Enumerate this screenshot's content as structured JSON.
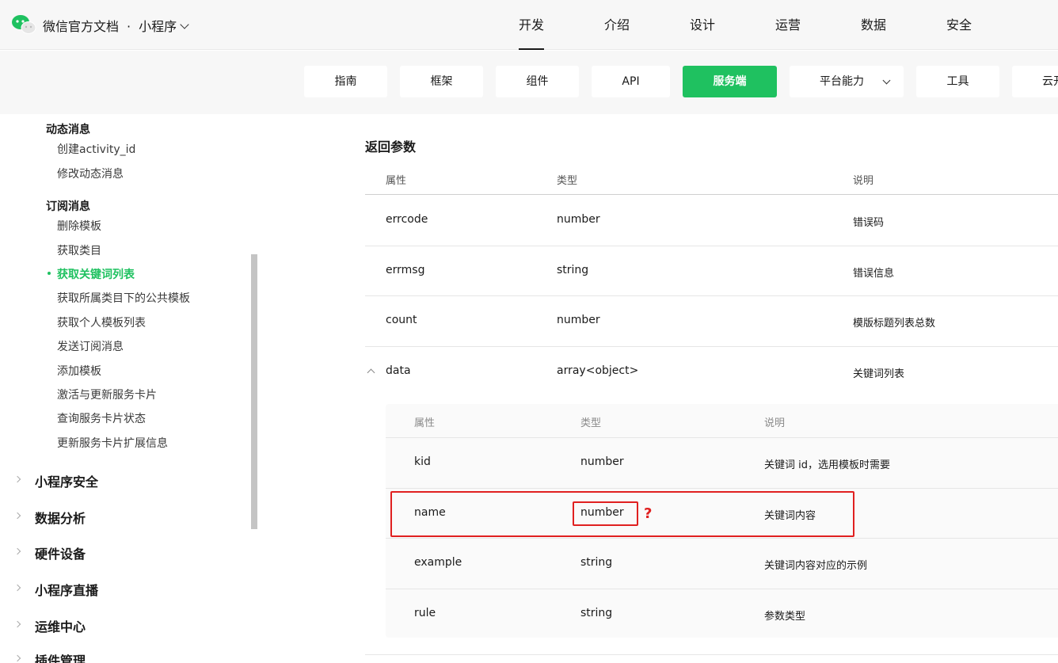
{
  "header": {
    "brand": "微信官方文档",
    "dot": "·",
    "section": "小程序",
    "nav": [
      "开发",
      "介绍",
      "设计",
      "运营",
      "数据",
      "安全"
    ],
    "active_nav": "开发"
  },
  "subnav": {
    "items": [
      "指南",
      "框架",
      "组件",
      "API",
      "服务端",
      "平台能力",
      "工具",
      "云开"
    ],
    "active": "服务端"
  },
  "sidebar": {
    "group1_title": "动态消息",
    "group1_links": [
      "创建activity_id",
      "修改动态消息"
    ],
    "group2_title": "订阅消息",
    "group2_links": [
      "删除模板",
      "获取类目",
      "获取关键词列表",
      "获取所属类目下的公共模板",
      "获取个人模板列表",
      "发送订阅消息",
      "添加模板",
      "激活与更新服务卡片",
      "查询服务卡片状态",
      "更新服务卡片扩展信息"
    ],
    "active_link": "获取关键词列表",
    "sections": [
      "小程序安全",
      "数据分析",
      "硬件设备",
      "小程序直播",
      "运维中心",
      "插件管理"
    ]
  },
  "main": {
    "title": "返回参数",
    "headers": {
      "attr": "属性",
      "type": "类型",
      "desc": "说明"
    },
    "rows": [
      {
        "attr": "errcode",
        "type": "number",
        "desc": "错误码"
      },
      {
        "attr": "errmsg",
        "type": "string",
        "desc": "错误信息"
      },
      {
        "attr": "count",
        "type": "number",
        "desc": "模版标题列表总数"
      },
      {
        "attr": "data",
        "type": "array<object>",
        "desc": "关键词列表"
      }
    ],
    "nested_headers": {
      "attr": "属性",
      "type": "类型",
      "desc": "说明"
    },
    "nested_rows": [
      {
        "attr": "kid",
        "type": "number",
        "desc": "关键词 id，选用模板时需要"
      },
      {
        "attr": "name",
        "type": "number",
        "desc": "关键词内容"
      },
      {
        "attr": "example",
        "type": "string",
        "desc": "关键词内容对应的示例"
      },
      {
        "attr": "rule",
        "type": "string",
        "desc": "参数类型"
      }
    ],
    "annotation": "?"
  },
  "colors": {
    "accent": "#1fc160",
    "annotation": "#e02020"
  }
}
